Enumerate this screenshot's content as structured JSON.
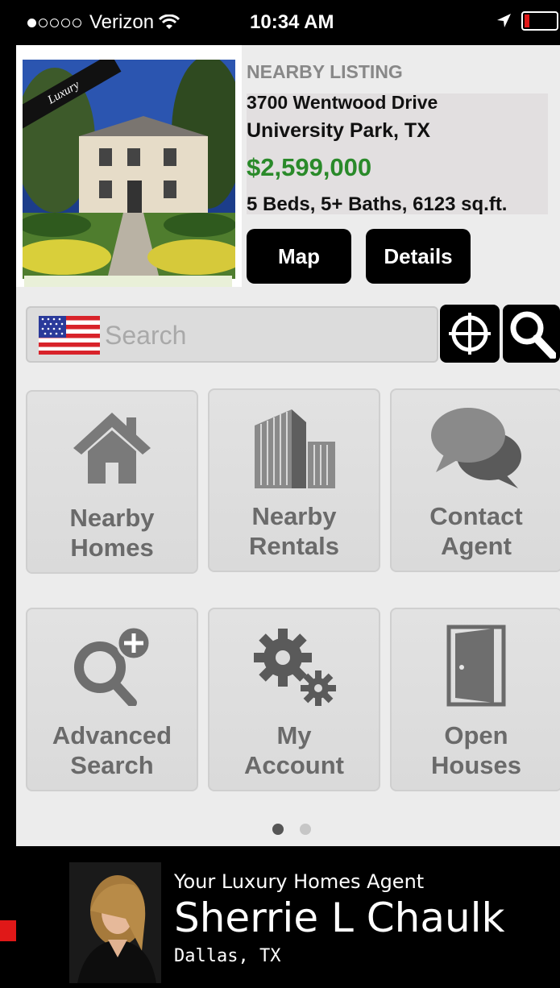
{
  "status_bar": {
    "carrier": "Verizon",
    "signal_bars_filled": 1,
    "signal_bars_total": 5,
    "time": "10:34 AM",
    "battery_level": 0.1,
    "battery_color": "#e01818"
  },
  "listing": {
    "badge": "Luxury",
    "kicker": "NEARBY LISTING",
    "street": "3700 Wentwood Drive",
    "city": "University Park, TX",
    "price": "$2,599,000",
    "specs": "5 Beds, 5+ Baths, 6123 sq.ft.",
    "price_color": "#2a8a2a",
    "map_label": "Map",
    "details_label": "Details"
  },
  "search": {
    "placeholder": "Search",
    "flag_icon": "us-flag-icon",
    "locate_icon": "crosshair-icon",
    "search_icon": "magnifier-icon"
  },
  "tiles": [
    {
      "label": "Nearby\nHomes",
      "icon": "house-icon"
    },
    {
      "label": "Nearby\nRentals",
      "icon": "buildings-icon"
    },
    {
      "label": "Contact\nAgent",
      "icon": "chat-bubbles-icon"
    },
    {
      "label": "Advanced\nSearch",
      "icon": "search-plus-icon"
    },
    {
      "label": "My\nAccount",
      "icon": "gears-icon"
    },
    {
      "label": "Open\nHouses",
      "icon": "door-icon"
    }
  ],
  "pager": {
    "pages": 2,
    "current": 1
  },
  "agent": {
    "kicker": "Your Luxury Homes Agent",
    "name": "Sherrie L Chaulk",
    "location": "Dallas, TX"
  }
}
